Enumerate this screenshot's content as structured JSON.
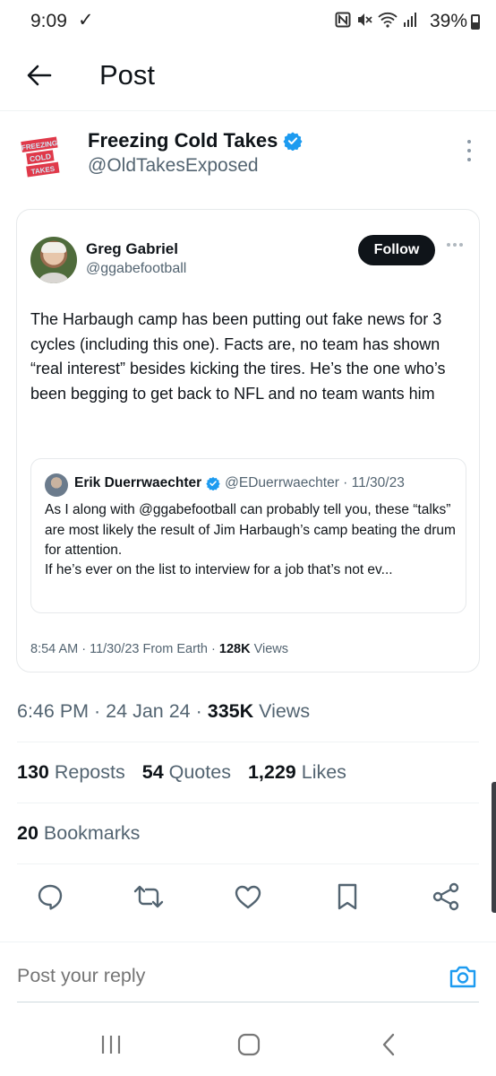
{
  "status_bar": {
    "time": "9:09",
    "check": "✓",
    "battery": "39%"
  },
  "header": {
    "title": "Post"
  },
  "author": {
    "name": "Freezing Cold Takes",
    "handle": "@OldTakesExposed",
    "logo_lines": [
      "FREEZING",
      "COLD",
      "TAKES"
    ]
  },
  "embedded_tweet": {
    "name": "Greg Gabriel",
    "handle": "@ggabefootball",
    "follow_label": "Follow",
    "text": "The Harbaugh camp has been putting out fake news for 3 cycles (including this one). Facts are, no team has shown “real interest” besides kicking the tires. He’s the one who’s been begging to get back to NFL and no team wants him",
    "quoted": {
      "name": "Erik Duerrwaechter",
      "handle_date": "@EDuerrwaechter · 11/30/23",
      "text": "As I along with @ggabefootball can probably tell you, these “talks” are most likely the result of Jim Harbaugh’s camp beating the drum for attention.",
      "text2": "If he’s ever on the list to interview for a job that’s not ev..."
    },
    "meta_prefix": "8:54 AM · 11/30/23 From Earth · ",
    "meta_views_count": "128K",
    "meta_views_label": " Views"
  },
  "post_meta": {
    "time_date": "6:46 PM · 24 Jan 24 · ",
    "views_count": "335K",
    "views_label": " Views"
  },
  "stats": {
    "reposts_count": "130",
    "reposts_label": " Reposts",
    "quotes_count": "54",
    "quotes_label": " Quotes",
    "likes_count": "1,229",
    "likes_label": " Likes",
    "bookmarks_count": "20",
    "bookmarks_label": " Bookmarks"
  },
  "reply": {
    "placeholder": "Post your reply"
  },
  "colors": {
    "accent": "#1d9bf0",
    "text": "#0f1419",
    "secondary": "#536471",
    "logo_red": "#e0394a"
  },
  "icons": {
    "back": "arrow-left-icon",
    "verified": "verified-badge-icon",
    "reply": "reply-icon",
    "repost": "repost-icon",
    "like": "heart-icon",
    "bookmark": "bookmark-icon",
    "share": "share-icon",
    "camera": "camera-icon"
  }
}
